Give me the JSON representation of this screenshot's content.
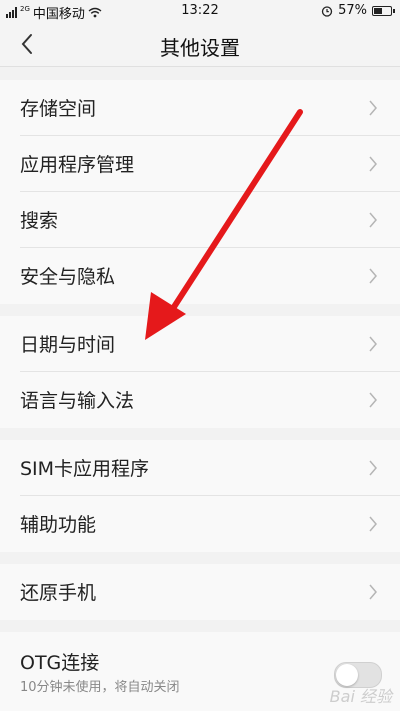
{
  "status_bar": {
    "network_tag": "2G",
    "carrier": "中国移动",
    "time": "13:22",
    "battery_percent": "57%",
    "battery_level": 0.57
  },
  "header": {
    "title": "其他设置"
  },
  "groups": [
    {
      "items": [
        "存储空间",
        "应用程序管理",
        "搜索",
        "安全与隐私"
      ]
    },
    {
      "items": [
        "日期与时间",
        "语言与输入法"
      ]
    },
    {
      "items": [
        "SIM卡应用程序",
        "辅助功能"
      ]
    },
    {
      "items": [
        "还原手机"
      ]
    }
  ],
  "otg": {
    "label": "OTG连接",
    "subtitle": "10分钟未使用，将自动关闭",
    "enabled": false
  },
  "colors": {
    "annotation_arrow": "#e5191b",
    "background": "#f2f2f2"
  },
  "watermark": "Bai 经验"
}
